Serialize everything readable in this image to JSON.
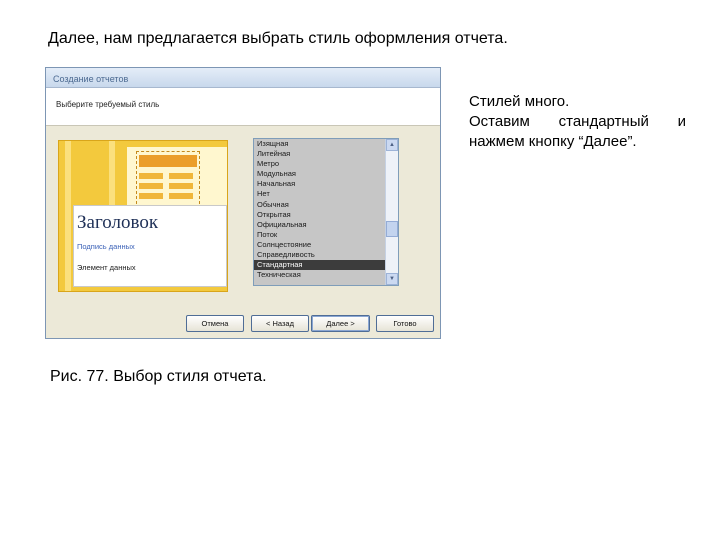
{
  "slide": {
    "heading": "Далее, нам предлагается выбрать стиль оформления отчета.",
    "note": [
      "Стилей много.",
      "Оставим стандартный и",
      "нажмем кнопку “Далее”."
    ],
    "caption": "Рис. 77. Выбор стиля отчета."
  },
  "dialog": {
    "title": "Создание отчетов",
    "subtitle": "Выберите требуемый стиль",
    "preview": {
      "title": "Заголовок",
      "subtitle": "Подпись данных",
      "field": "Элемент данных"
    },
    "styles": [
      "Изящная",
      "Литейная",
      "Метро",
      "Модульная",
      "Начальная",
      "Нет",
      "Обычная",
      "Открытая",
      "Официальная",
      "Поток",
      "Солнцестояние",
      "Справедливость",
      "Стандартная",
      "Техническая"
    ],
    "selected_style": "Стандартная",
    "buttons": {
      "cancel": "Отмена",
      "back": "< Назад",
      "next": "Далее >",
      "finish": "Готово"
    }
  }
}
